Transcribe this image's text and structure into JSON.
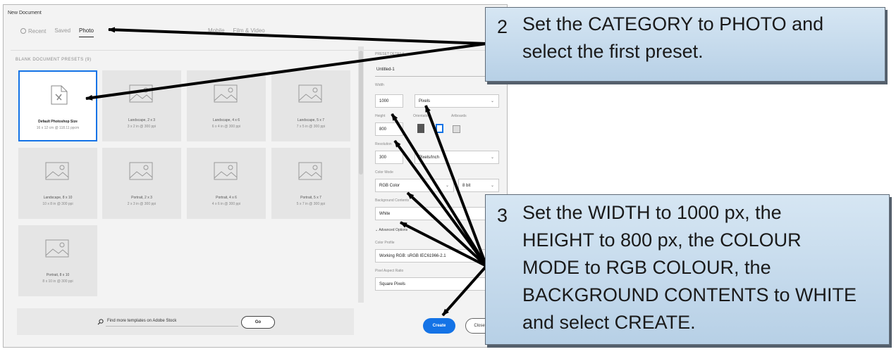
{
  "window": {
    "title": "New Document",
    "tabs": [
      {
        "label": "Recent",
        "active": false
      },
      {
        "label": "Saved",
        "active": false
      },
      {
        "label": "Photo",
        "active": true
      },
      {
        "label": "Mobile",
        "active": false
      },
      {
        "label": "Film & Video",
        "active": false
      }
    ]
  },
  "presets": {
    "heading": "BLANK DOCUMENT PRESETS (9)",
    "items": [
      {
        "name": "Default Photoshop Size",
        "desc": "16 x 12 cm @ 118.11 ppcm",
        "selected": true
      },
      {
        "name": "Landscape, 2 x 3",
        "desc": "3 x 2 in @ 300 ppi"
      },
      {
        "name": "Landscape, 4 x 6",
        "desc": "6 x 4 in @ 300 ppi"
      },
      {
        "name": "Landscape, 5 x 7",
        "desc": "7 x 5 in @ 300 ppi"
      },
      {
        "name": "Landscape, 8 x 10",
        "desc": "10 x 8 in @ 300 ppi"
      },
      {
        "name": "Portrait, 2 x 3",
        "desc": "2 x 3 in @ 300 ppi"
      },
      {
        "name": "Portrait, 4 x 6",
        "desc": "4 x 6 in @ 300 ppi"
      },
      {
        "name": "Portrait, 5 x 7",
        "desc": "5 x 7 in @ 300 ppi"
      },
      {
        "name": "Portrait, 8 x 10",
        "desc": "8 x 10 in @ 300 ppi"
      }
    ]
  },
  "find": {
    "text": "Find more templates on Adobe Stock",
    "go_label": "Go"
  },
  "details": {
    "section_label": "PRESET DETAILS",
    "doc_name": "Untitled-1",
    "width_label": "Width",
    "width_value": "1000",
    "width_unit": "Pixels",
    "height_label": "Height",
    "height_value": "800",
    "orientation_label": "Orientation",
    "artboards_label": "Artboards",
    "resolution_label": "Resolution",
    "resolution_value": "300",
    "resolution_unit": "Pixels/Inch",
    "color_mode_label": "Color Mode",
    "color_mode_value": "RGB Color",
    "bit_depth_value": "8 bit",
    "bg_label": "Background Contents",
    "bg_value": "White",
    "advanced_label": "Advanced Options",
    "profile_label": "Color Profile",
    "profile_value": "Working RGB: sRGB IEC61966-2.1",
    "aspect_label": "Pixel Aspect Ratio",
    "aspect_value": "Square Pixels"
  },
  "buttons": {
    "create": "Create",
    "close": "Close"
  },
  "callouts": {
    "step2_num": "2",
    "step2_lines": [
      "Set the CATEGORY to PHOTO and",
      "select the first preset."
    ],
    "step3_num": "3",
    "step3_lines": [
      "Set the WIDTH to 1000 px, the",
      "HEIGHT to 800 px, the COLOUR",
      "MODE to RGB COLOUR, the",
      "BACKGROUND CONTENTS to WHITE",
      "and select CREATE."
    ]
  },
  "colors": {
    "accent": "#1473e6",
    "callout_fill": "#c6dbee",
    "arrow": "#000000"
  }
}
